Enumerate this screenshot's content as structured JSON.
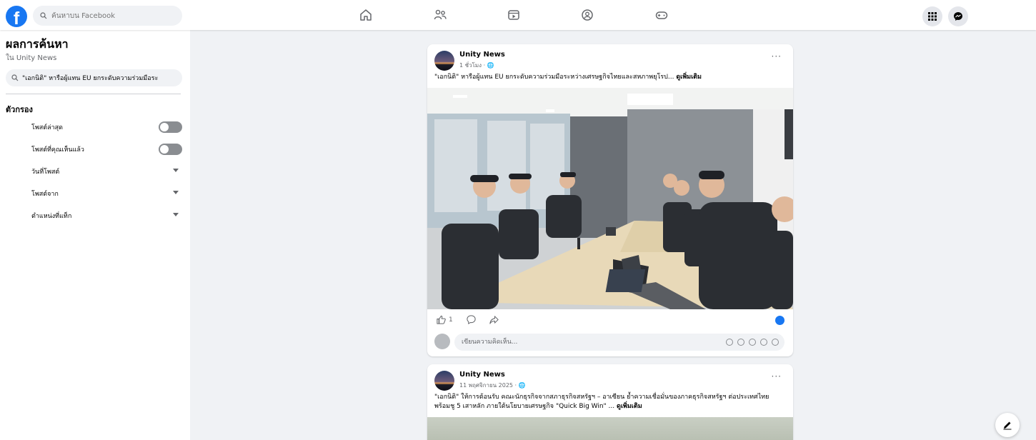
{
  "app": {
    "logo": "f"
  },
  "top_search": {
    "placeholder": "ค้นหาบน Facebook"
  },
  "sidebar": {
    "title": "ผลการค้นหา",
    "subtitle": "ใน Unity News",
    "search_value": "\"เอกนิติ\" หารือผู้แทน EU ยกระดับความร่วมมือระ",
    "filters_title": "ตัวกรอง",
    "filters": [
      {
        "label": "โพสต์ล่าสุด",
        "type": "toggle"
      },
      {
        "label": "โพสต์ที่คุณเห็นแล้ว",
        "type": "toggle"
      },
      {
        "label": "วันที่โพสต์",
        "type": "dropdown"
      },
      {
        "label": "โพสต์จาก",
        "type": "dropdown"
      },
      {
        "label": "ตำแหน่งที่แท็ก",
        "type": "dropdown"
      }
    ]
  },
  "posts": [
    {
      "page_name": "Unity News",
      "meta": "1 ชั่วโมง · 🌐",
      "text": "\"เอกนิติ\" หารือผู้แทน EU ยกระดับความร่วมมือระหว่างเศรษฐกิจไทยและสหภาพยุโรป...",
      "see_more": "ดูเพิ่มเติม",
      "like_count": "1",
      "comment_placeholder": "เขียนความคิดเห็น..."
    },
    {
      "page_name": "Unity News",
      "meta": "11 พฤศจิกายน 2025 · 🌐",
      "text": "\"เอกนิติ\" ให้การต้อนรับ คณะนักธุรกิจจากสภาธุรกิจสหรัฐฯ – อาเซียน ย้ำความเชื่อมั่นของภาคธุรกิจสหรัฐฯ ต่อประเทศไทย พร้อมชู 5 เสาหลัก ภายใต้นโยบายเศรษฐกิจ \"Quick Big Win\" ...",
      "see_more": "ดูเพิ่มเติม"
    }
  ],
  "more_label": "···",
  "colors": {
    "brand": "#1877f2",
    "background": "#f0f2f5"
  }
}
